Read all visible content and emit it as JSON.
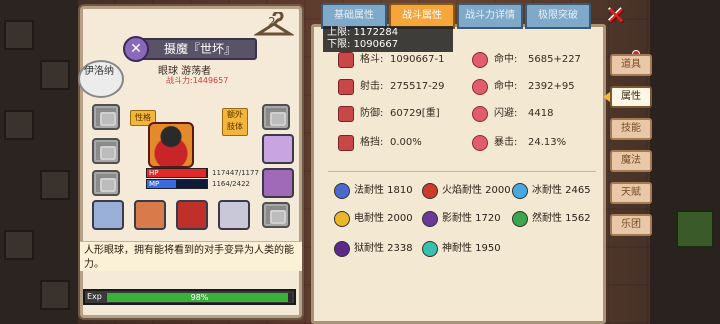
{
  "hero": {
    "name": "摄魔『世坏』",
    "class_icon": "✕",
    "subtitle": "眼球 游荡者",
    "power": "战斗力:1449657",
    "avatar_text": "伊洛纳",
    "tag_personality": "性格",
    "tag_extra": "额外肢体",
    "hp_label": "HP",
    "hp_value": "117447/1177",
    "hp_fraction": 0.99,
    "mp_label": "MP",
    "mp_value": "1164/2422",
    "mp_fraction": 0.48,
    "description": "人形眼球，拥有能将看到的对手变异为人类的能力。",
    "exp_label": "Exp",
    "exp_percent": "98%",
    "exp_fraction": 0.98
  },
  "tabs": [
    {
      "label": "基础属性",
      "active": false
    },
    {
      "label": "战斗属性",
      "active": true
    },
    {
      "label": "战斗力详情",
      "active": false
    },
    {
      "label": "极限突破",
      "active": false
    }
  ],
  "limits": {
    "upper": "上限: 1172284",
    "lower": "下限: 1090667"
  },
  "stats": [
    {
      "label": "格斗:",
      "value": "1090667-1",
      "icon": "fist-icon"
    },
    {
      "label": "命中:",
      "value": "5685+227",
      "icon": "target-icon"
    },
    {
      "label": "射击:",
      "value": "275517-29",
      "icon": "bow-icon"
    },
    {
      "label": "命中:",
      "value": "2392+95",
      "icon": "target-icon"
    },
    {
      "label": "防御:",
      "value": "60729[重]",
      "icon": "shield-icon"
    },
    {
      "label": "闪避:",
      "value": "4418",
      "icon": "dodge-icon"
    },
    {
      "label": "格挡:",
      "value": "0.00%",
      "icon": "block-icon"
    },
    {
      "label": "暴击:",
      "value": "24.13%",
      "icon": "crit-icon"
    }
  ],
  "resistances": [
    {
      "label": "法耐性 1810",
      "color": "#4a6ad0"
    },
    {
      "label": "火焰耐性 2000",
      "color": "#d03a2a"
    },
    {
      "label": "冰耐性 2465",
      "color": "#4aa8e0"
    },
    {
      "label": "电耐性 2000",
      "color": "#e8b82a"
    },
    {
      "label": "影耐性 1720",
      "color": "#6a3a9a"
    },
    {
      "label": "然耐性 1562",
      "color": "#3aa84a"
    },
    {
      "label": "狱耐性 2338",
      "color": "#5a2a8a"
    },
    {
      "label": "神耐性 1950",
      "color": "#3ac0b0"
    }
  ],
  "side_tabs": [
    {
      "label": "道具",
      "active": false
    },
    {
      "label": "属性",
      "active": true
    },
    {
      "label": "技能",
      "active": false
    },
    {
      "label": "魔法",
      "active": false
    },
    {
      "label": "天赋",
      "active": false
    },
    {
      "label": "乐团",
      "active": false
    }
  ],
  "close_icon": "close-icon"
}
